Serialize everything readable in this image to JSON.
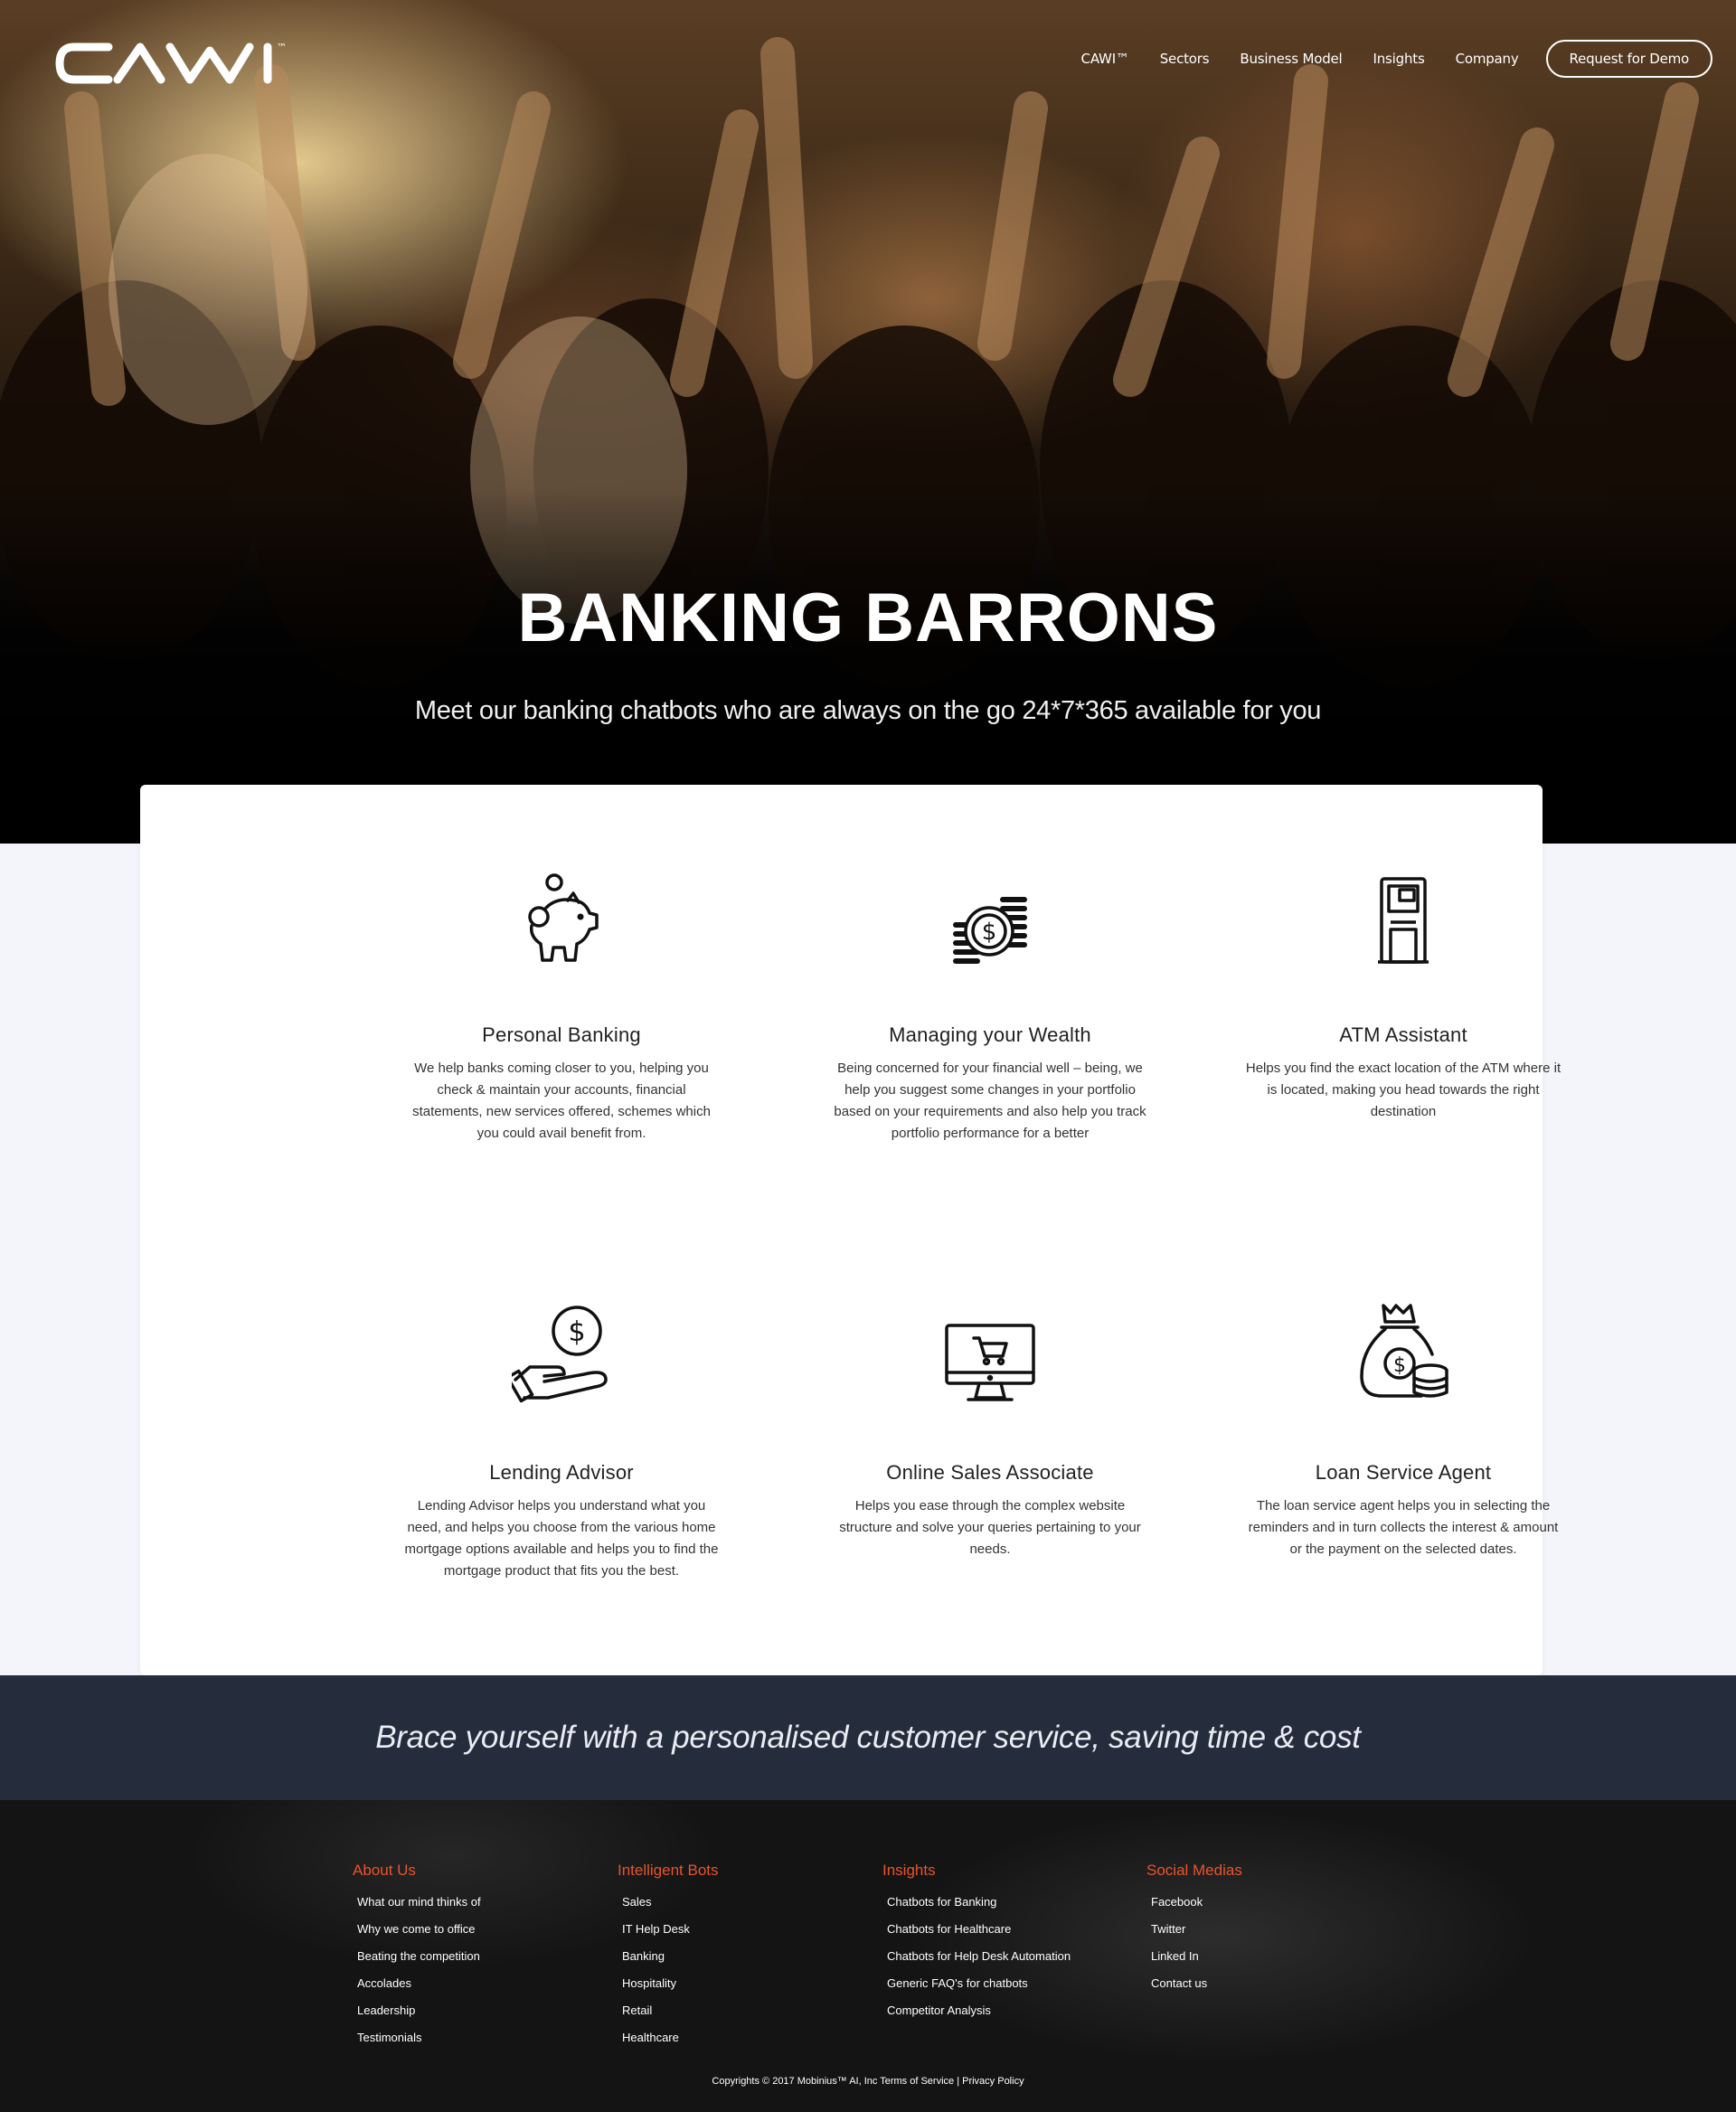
{
  "header": {
    "logo_text": "CAWI",
    "logo_tm": "™",
    "nav": [
      {
        "label": "CAWI™"
      },
      {
        "label": "Sectors"
      },
      {
        "label": "Business Model"
      },
      {
        "label": "Insights"
      },
      {
        "label": "Company"
      }
    ],
    "cta_label": "Request for Demo"
  },
  "hero": {
    "title": "BANKING BARRONS",
    "subtitle": "Meet our banking chatbots who are always on the go 24*7*365 available for you"
  },
  "features": [
    {
      "icon": "piggy-bank-icon",
      "title": "Personal Banking",
      "text": "We help banks coming closer to you, helping you check & maintain your accounts, financial statements, new services offered, schemes which you could avail benefit from."
    },
    {
      "icon": "coins-icon",
      "title": "Managing your Wealth",
      "text": "Being concerned for your financial well – being, we help you suggest some changes in your portfolio based on your requirements and also help you track portfolio performance for a better"
    },
    {
      "icon": "atm-icon",
      "title": "ATM Assistant",
      "text": "Helps you find the exact location of the ATM where it is located, making you head towards the right destination"
    },
    {
      "icon": "hand-coin-icon",
      "title": "Lending Advisor",
      "text": "Lending Advisor helps you understand what you need, and helps you choose from the various home mortgage options available and helps you to find the mortgage product that fits you the best."
    },
    {
      "icon": "monitor-cart-icon",
      "title": "Online Sales Associate",
      "text": "Helps you ease through the complex website structure and solve your queries pertaining to your needs."
    },
    {
      "icon": "money-bag-icon",
      "title": "Loan Service Agent",
      "text": "The loan service agent helps you in selecting the reminders and in turn collects the interest & amount or the payment on the selected dates."
    }
  ],
  "banner": {
    "text": "Brace yourself with a personalised customer service, saving time & cost"
  },
  "footer": {
    "columns": [
      {
        "title": "About Us",
        "links": [
          "What our mind thinks of",
          "Why we come to office",
          "Beating the competition",
          "Accolades",
          "Leadership",
          "Testimonials"
        ]
      },
      {
        "title": "Intelligent Bots",
        "links": [
          "Sales",
          "IT Help Desk",
          "Banking",
          "Hospitality",
          "Retail",
          "Healthcare"
        ]
      },
      {
        "title": "Insights",
        "links": [
          "Chatbots for Banking",
          "Chatbots for Healthcare",
          "Chatbots for Help Desk Automation",
          "Generic FAQ's for chatbots",
          "Competitor Analysis"
        ]
      },
      {
        "title": "Social Medias",
        "links": [
          "Facebook",
          "Twitter",
          "Linked In",
          "Contact us"
        ]
      }
    ],
    "copyright": "Copyrights © 2017 Mobinius™ AI, Inc Terms of Service | Privacy Policy"
  },
  "colors": {
    "banner_bg": "#252c3b",
    "footer_heading": "#e8542c",
    "page_bg": "#f4f5fa"
  }
}
